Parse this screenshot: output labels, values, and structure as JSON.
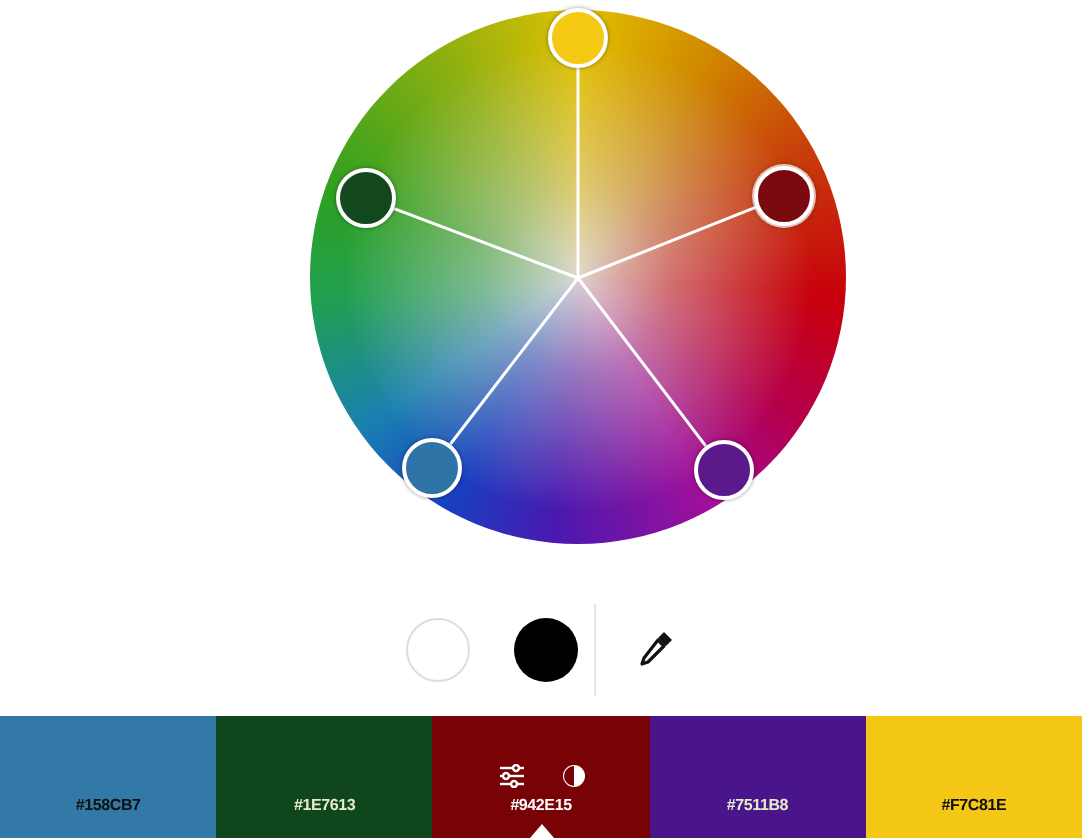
{
  "wheel": {
    "handles": [
      {
        "color": "#f5c814",
        "selected": false
      },
      {
        "color": "#7a0a10",
        "selected": true
      },
      {
        "color": "#5a1a8c",
        "selected": false
      },
      {
        "color": "#2f74a6",
        "selected": false
      },
      {
        "color": "#12481c",
        "selected": false
      }
    ]
  },
  "tools": [
    {
      "kind": "white",
      "selected": false
    },
    {
      "kind": "black",
      "selected": false
    },
    {
      "kind": "eyedropper"
    }
  ],
  "swatches": [
    {
      "label": "#158CB7",
      "color": "#3279a7",
      "selected": false
    },
    {
      "label": "#1E7613",
      "color": "#0f461c",
      "selected": false
    },
    {
      "label": "#942E15",
      "color": "#780206",
      "selected": true
    },
    {
      "label": "#7511B8",
      "color": "#4a148a",
      "selected": false
    },
    {
      "label": "#F7C81E",
      "color": "#f4c616",
      "selected": false
    }
  ]
}
